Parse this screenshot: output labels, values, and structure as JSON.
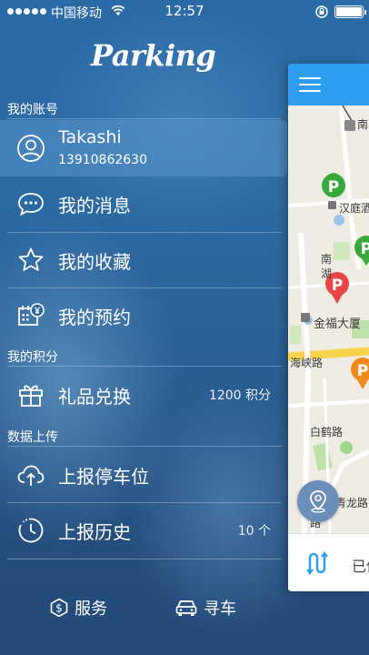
{
  "status_bar": {
    "carrier": "中国移动",
    "time": "12:57"
  },
  "app": {
    "logo_text": "Parking"
  },
  "sections": {
    "account_label": "我的账号",
    "points_label": "我的积分",
    "upload_label": "数据上传"
  },
  "account": {
    "name": "Takashi",
    "phone": "13910862630"
  },
  "menu": {
    "messages": "我的消息",
    "favorites": "我的收藏",
    "reservations": "我的预约",
    "gifts": "礼品兑换",
    "gifts_value": "1200 积分",
    "report_parking": "上报停车位",
    "report_history": "上报历史",
    "report_history_value": "10 个"
  },
  "bottom": {
    "service": "服务",
    "find_car": "寻车"
  },
  "map": {
    "labels": {
      "top_partial": "南",
      "han_ting": "汉庭酒",
      "nan_hu_1": "南",
      "nan_hu_2": "湖",
      "jin_fu": "金福大厦",
      "hai_xia": "海峡路",
      "bai_he": "白鹤路",
      "qing_long": "青龙路",
      "lu": "路"
    },
    "footer_text": "已传"
  },
  "colors": {
    "accent_blue": "#2f9ef0",
    "marker_green": "#3aa83a",
    "marker_red": "#e84545",
    "marker_orange": "#f08a1c"
  }
}
